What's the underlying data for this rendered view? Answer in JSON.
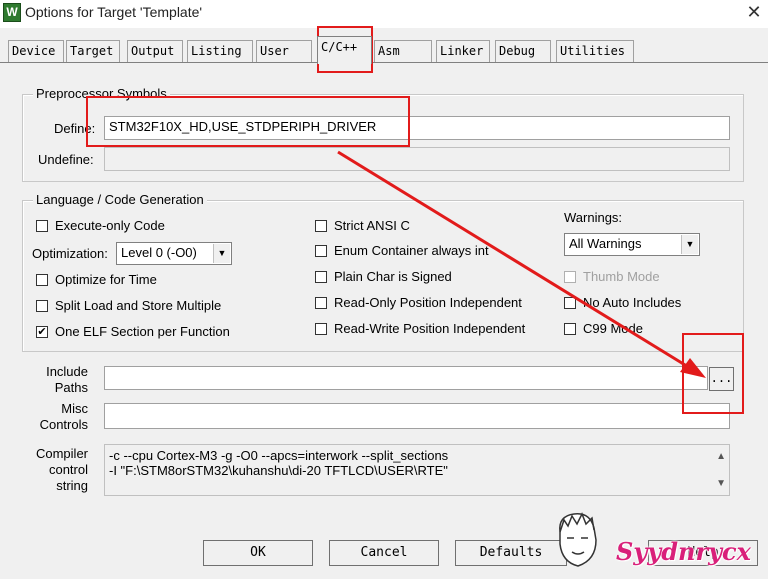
{
  "window": {
    "title": "Options for Target 'Template'",
    "app_icon_glyph": "W"
  },
  "tabs": [
    "Device",
    "Target",
    "Output",
    "Listing",
    "User",
    "C/C++",
    "Asm",
    "Linker",
    "Debug",
    "Utilities"
  ],
  "active_tab": "C/C++",
  "preprocessor": {
    "group_title": "Preprocessor Symbols",
    "define_label": "Define:",
    "define_value": "STM32F10X_HD,USE_STDPERIPH_DRIVER",
    "undefine_label": "Undefine:",
    "undefine_value": ""
  },
  "codegen": {
    "group_title": "Language / Code Generation",
    "execute_only": "Execute-only Code",
    "optimization_label": "Optimization:",
    "optimization_value": "Level 0 (-O0)",
    "optimize_time": "Optimize for Time",
    "split_load": "Split Load and Store Multiple",
    "one_elf": "One ELF Section per Function",
    "strict_ansi": "Strict ANSI C",
    "enum_container": "Enum Container always int",
    "plain_char": "Plain Char is Signed",
    "ro_pi": "Read-Only Position Independent",
    "rw_pi": "Read-Write Position Independent",
    "warnings_label": "Warnings:",
    "warnings_value": "All Warnings",
    "thumb_mode": "Thumb Mode",
    "no_auto_includes": "No Auto Includes",
    "c99_mode": "C99 Mode"
  },
  "include": {
    "paths_label_1": "Include",
    "paths_label_2": "Paths",
    "paths_value": "",
    "browse_label": "...",
    "misc_label_1": "Misc",
    "misc_label_2": "Controls",
    "misc_value": ""
  },
  "compiler": {
    "label_1": "Compiler",
    "label_2": "control",
    "label_3": "string",
    "line_1": "-c --cpu Cortex-M3 -g -O0 --apcs=interwork --split_sections",
    "line_2": "-I \"F:\\STM8orSTM32\\kuhanshu\\di-20 TFTLCD\\USER\\RTE\""
  },
  "buttons": {
    "ok": "OK",
    "cancel": "Cancel",
    "defaults": "Defaults",
    "help": "Help"
  },
  "watermark": {
    "text": "Syydnrycx"
  },
  "annotation_color": "#e21b1b"
}
